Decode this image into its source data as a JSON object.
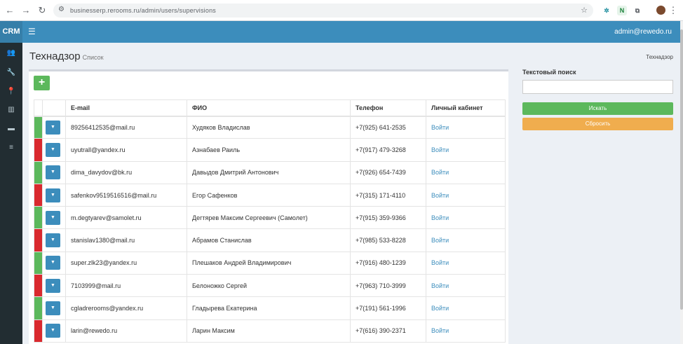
{
  "browser": {
    "url": "businesserp.rerooms.ru/admin/users/supervisions",
    "ext_n": "N"
  },
  "header": {
    "logo": "CRM",
    "user": "admin@rewedo.ru"
  },
  "page": {
    "title": "Технадзор",
    "subtitle": "Список",
    "breadcrumb": "Технадзор"
  },
  "add_button": "+",
  "table": {
    "headers": [
      "E-mail",
      "ФИО",
      "Телефон",
      "Личный кабинет"
    ],
    "rows": [
      {
        "status": "#5cb85c",
        "email": "89256412535@mail.ru",
        "name": "Худяков Владислав",
        "phone": "+7(925) 641-2535",
        "action": "Войти"
      },
      {
        "status": "#d9292e",
        "email": "uyutrall@yandex.ru",
        "name": "Азнабаев Раиль",
        "phone": "+7(917) 479-3268",
        "action": "Войти"
      },
      {
        "status": "#5cb85c",
        "email": "dima_davydov@bk.ru",
        "name": "Давыдов Дмитрий Антонович",
        "phone": "+7(926) 654-7439",
        "action": "Войти"
      },
      {
        "status": "#d9292e",
        "email": "safenkov9519516516@mail.ru",
        "name": "Егор Сафенков",
        "phone": "+7(315) 171-4110",
        "action": "Войти"
      },
      {
        "status": "#5cb85c",
        "email": "m.degtyarev@samolet.ru",
        "name": "Дегтярев Максим Сергеевич (Самолет)",
        "phone": "+7(915) 359-9366",
        "action": "Войти"
      },
      {
        "status": "#d9292e",
        "email": "stanislav1380@mail.ru",
        "name": "Абрамов Станислав",
        "phone": "+7(985) 533-8228",
        "action": "Войти"
      },
      {
        "status": "#5cb85c",
        "email": "super.zlk23@yandex.ru",
        "name": "Плешаков Андрей Владимирович",
        "phone": "+7(916) 480-1239",
        "action": "Войти"
      },
      {
        "status": "#d9292e",
        "email": "7103999@mail.ru",
        "name": "Белоножко Сергей",
        "phone": "+7(963) 710-3999",
        "action": "Войти"
      },
      {
        "status": "#5cb85c",
        "email": "cgladrerooms@yandex.ru",
        "name": "Гладырева Екатерина",
        "phone": "+7(191) 561-1996",
        "action": "Войти"
      },
      {
        "status": "#d9292e",
        "email": "larin@rewedo.ru",
        "name": "Ларин Максим",
        "phone": "+7(616) 390-2371",
        "action": "Войти"
      }
    ]
  },
  "search": {
    "label": "Текстовый поиск",
    "value": "",
    "search_button": "Искать",
    "reset_button": "Сбросить"
  }
}
